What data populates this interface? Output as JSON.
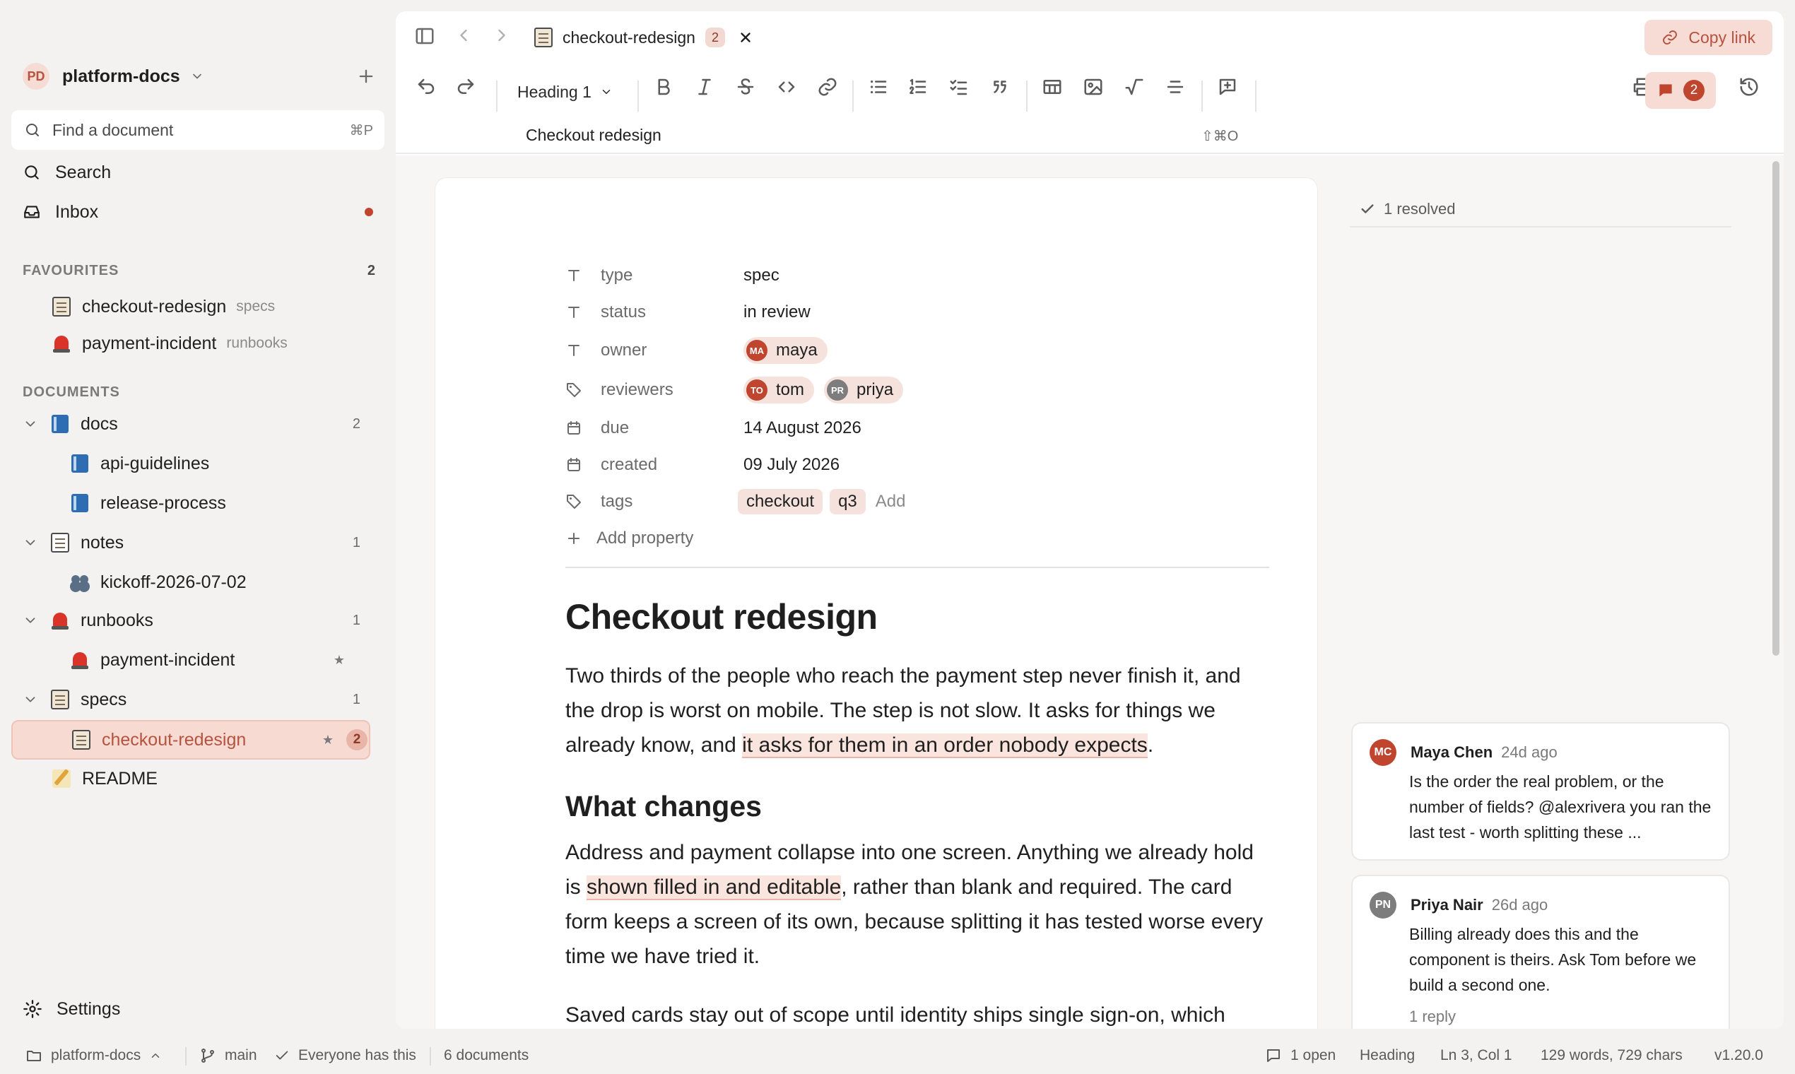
{
  "workspace": {
    "initials": "PD",
    "name": "platform-docs"
  },
  "find": {
    "placeholder": "Find a document",
    "shortcut": "⌘P"
  },
  "nav": {
    "search": "Search",
    "inbox": "Inbox"
  },
  "favourites": {
    "heading": "FAVOURITES",
    "count": "2",
    "items": [
      {
        "label": "checkout-redesign",
        "folder": "specs",
        "icon": "doc-icon"
      },
      {
        "label": "payment-incident",
        "folder": "runbooks",
        "icon": "siren-icon"
      }
    ]
  },
  "documents": {
    "heading": "DOCUMENTS",
    "tree": [
      {
        "label": "docs",
        "count": "2",
        "icon": "book-icon"
      },
      {
        "label": "api-guidelines",
        "icon": "book-icon"
      },
      {
        "label": "release-process",
        "icon": "book-icon"
      },
      {
        "label": "notes",
        "count": "1",
        "icon": "notepad-icon"
      },
      {
        "label": "kickoff-2026-07-02",
        "icon": "people-icon"
      },
      {
        "label": "runbooks",
        "count": "1",
        "icon": "siren-icon"
      },
      {
        "label": "payment-incident",
        "star": "★",
        "icon": "siren-icon"
      },
      {
        "label": "specs",
        "count": "1",
        "icon": "doc-icon"
      },
      {
        "label": "checkout-redesign",
        "star": "★",
        "comments": "2",
        "icon": "doc-icon"
      },
      {
        "label": "README",
        "icon": "memo-icon"
      }
    ]
  },
  "settings": {
    "label": "Settings"
  },
  "tab": {
    "title": "checkout-redesign",
    "count": "2"
  },
  "copy_link": "Copy link",
  "toolbar": {
    "heading_select": "Heading 1",
    "comment_count": "2"
  },
  "breadcrumb": {
    "title": "Checkout redesign",
    "shortcut": "⇧⌘O"
  },
  "properties": [
    {
      "name": "type",
      "value": "spec",
      "icon": "text-icon"
    },
    {
      "name": "status",
      "value": "in review",
      "icon": "text-icon"
    },
    {
      "name": "owner",
      "icon": "text-icon",
      "people": [
        {
          "initials": "MA",
          "name": "maya",
          "color": "#c0452e"
        }
      ]
    },
    {
      "name": "reviewers",
      "icon": "tag-icon",
      "people": [
        {
          "initials": "TO",
          "name": "tom",
          "color": "#c0452e"
        },
        {
          "initials": "PR",
          "name": "priya",
          "color": "#7d7d7d"
        }
      ]
    },
    {
      "name": "due",
      "value": "14 August 2026",
      "icon": "calendar-icon"
    },
    {
      "name": "created",
      "value": "09 July 2026",
      "icon": "calendar-icon"
    },
    {
      "name": "tags",
      "icon": "tag-icon",
      "tags": [
        "checkout",
        "q3"
      ],
      "add": "Add"
    }
  ],
  "add_property": "Add property",
  "doc": {
    "h1": "Checkout redesign",
    "p1_a": "Two thirds of the people who reach the payment step never finish it, and the drop is worst on mobile. The step is not slow. It asks for things we already know, and ",
    "p1_hl": "it asks for them in an order nobody expects",
    "p1_b": ".",
    "h2": "What changes",
    "p2_a": "Address and payment collapse into one screen. Anything we already hold is ",
    "p2_hl": "shown filled in and editable",
    "p2_b": ", rather than blank and required. The card form keeps a screen of its own, because splitting it has tested worse every time we have tried it.",
    "p3": "Saved cards stay out of scope until identity ships single sign-on, which"
  },
  "comments": {
    "resolved": "1 resolved",
    "threads": [
      {
        "initials": "MC",
        "author": "Maya Chen",
        "time": "24d ago",
        "color": "#c0452e",
        "body": "Is the order the real problem, or the number of fields? @alexrivera you ran the last test - worth splitting these ..."
      },
      {
        "initials": "PN",
        "author": "Priya Nair",
        "time": "26d ago",
        "color": "#7d7d7d",
        "body": "Billing already does this and the component is theirs. Ask Tom before we build a second one.",
        "reply": "1 reply"
      }
    ]
  },
  "status": {
    "workspace": "platform-docs",
    "branch": "main",
    "visibility": "Everyone has this",
    "documents": "6 documents",
    "open_comments": "1 open",
    "block_type": "Heading",
    "cursor": "Ln 3, Col 1",
    "counts": "129 words, 729 chars",
    "version": "v1.20.0"
  },
  "colors": {
    "accent": "#c0452e",
    "accent_bg": "#f6dcd5",
    "highlight": "#f9e4de"
  }
}
